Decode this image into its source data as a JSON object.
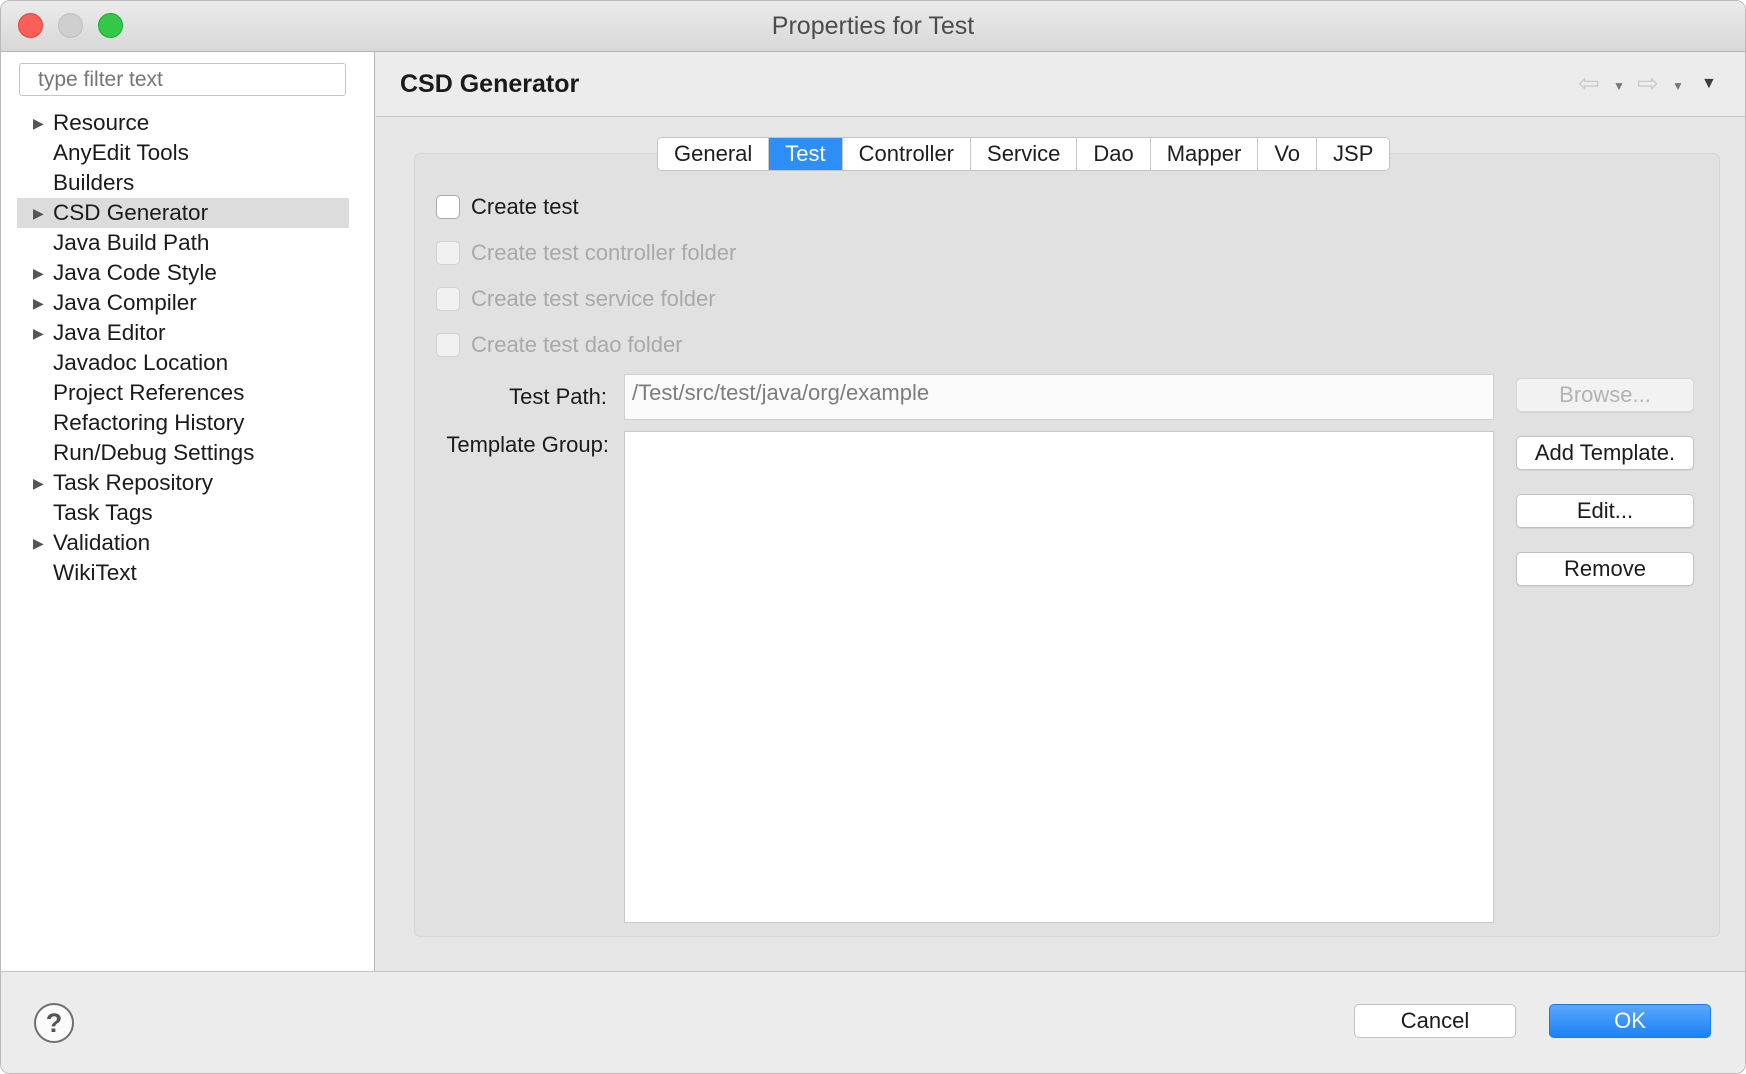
{
  "window": {
    "title": "Properties for Test"
  },
  "sidebar": {
    "filter_placeholder": "type filter text",
    "items": [
      {
        "label": "Resource",
        "expandable": true
      },
      {
        "label": "AnyEdit Tools",
        "expandable": false
      },
      {
        "label": "Builders",
        "expandable": false
      },
      {
        "label": "CSD Generator",
        "expandable": true,
        "selected": true
      },
      {
        "label": "Java Build Path",
        "expandable": false
      },
      {
        "label": "Java Code Style",
        "expandable": true
      },
      {
        "label": "Java Compiler",
        "expandable": true
      },
      {
        "label": "Java Editor",
        "expandable": true
      },
      {
        "label": "Javadoc Location",
        "expandable": false
      },
      {
        "label": "Project References",
        "expandable": false
      },
      {
        "label": "Refactoring History",
        "expandable": false
      },
      {
        "label": "Run/Debug Settings",
        "expandable": false
      },
      {
        "label": "Task Repository",
        "expandable": true
      },
      {
        "label": "Task Tags",
        "expandable": false
      },
      {
        "label": "Validation",
        "expandable": true
      },
      {
        "label": "WikiText",
        "expandable": false
      }
    ]
  },
  "header": {
    "title": "CSD Generator",
    "nav_icons": [
      "back-arrow-icon",
      "forward-arrow-icon",
      "view-menu-icon"
    ]
  },
  "tabs": [
    {
      "label": "General",
      "active": false
    },
    {
      "label": "Test",
      "active": true
    },
    {
      "label": "Controller",
      "active": false
    },
    {
      "label": "Service",
      "active": false
    },
    {
      "label": "Dao",
      "active": false
    },
    {
      "label": "Mapper",
      "active": false
    },
    {
      "label": "Vo",
      "active": false
    },
    {
      "label": "JSP",
      "active": false
    }
  ],
  "options": {
    "create_test": {
      "label": "Create test",
      "checked": false,
      "enabled": true
    },
    "controller_folder": {
      "label": "Create test controller folder",
      "checked": false,
      "enabled": false
    },
    "service_folder": {
      "label": "Create test service folder",
      "checked": false,
      "enabled": false
    },
    "dao_folder": {
      "label": "Create test dao folder",
      "checked": false,
      "enabled": false
    }
  },
  "test_path": {
    "label": "Test Path:",
    "value": "/Test/src/test/java/org/example"
  },
  "template_group": {
    "label": "Template Group:",
    "items": []
  },
  "buttons": {
    "browse": "Browse...",
    "add_template": "Add Template.",
    "edit": "Edit...",
    "remove": "Remove"
  },
  "footer": {
    "help_icon": "question-mark-icon",
    "cancel": "Cancel",
    "ok": "OK"
  },
  "colors": {
    "accent": "#2d8ff6",
    "selection": "#dcdcdc"
  }
}
